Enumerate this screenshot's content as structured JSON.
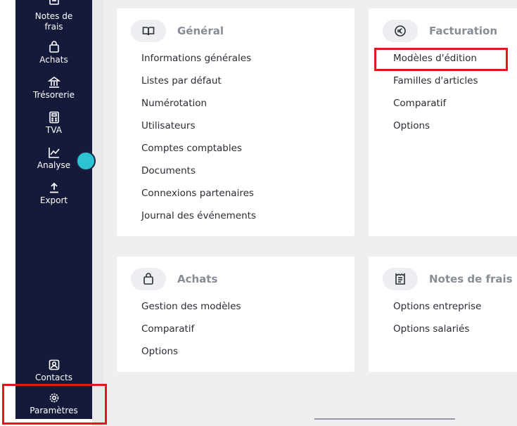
{
  "sidebar": {
    "items": [
      {
        "label": "Notes de\nfrais",
        "icon": "receipt-icon"
      },
      {
        "label": "Achats",
        "icon": "shopping-bag-icon"
      },
      {
        "label": "Trésorerie",
        "icon": "bank-icon"
      },
      {
        "label": "TVA",
        "icon": "calculator-icon"
      },
      {
        "label": "Analyse",
        "icon": "chart-line-icon"
      },
      {
        "label": "Export",
        "icon": "upload-icon"
      },
      {
        "label": "Contacts",
        "icon": "contact-icon"
      },
      {
        "label": "Paramètres",
        "icon": "gear-icon"
      }
    ]
  },
  "cards": {
    "general": {
      "title": "Général",
      "icon": "book-icon",
      "links": [
        "Informations générales",
        "Listes par défaut",
        "Numérotation",
        "Utilisateurs",
        "Comptes comptables",
        "Documents",
        "Connexions partenaires",
        "Journal des événements"
      ]
    },
    "facturation": {
      "title": "Facturation",
      "icon": "euro-icon",
      "links": [
        "Modèles d'édition",
        "Familles d'articles",
        "Comparatif",
        "Options"
      ]
    },
    "achats": {
      "title": "Achats",
      "icon": "shopping-bag-icon",
      "links": [
        "Gestion des modèles",
        "Comparatif",
        "Options"
      ]
    },
    "notes_de_frais": {
      "title": "Notes de frais",
      "icon": "receipt-icon",
      "links": [
        "Options entreprise",
        "Options salariés"
      ]
    }
  },
  "colors": {
    "sidebar_bg": "#161a3a",
    "accent_dot": "#2cc4d3",
    "highlight": "#e0181e"
  }
}
